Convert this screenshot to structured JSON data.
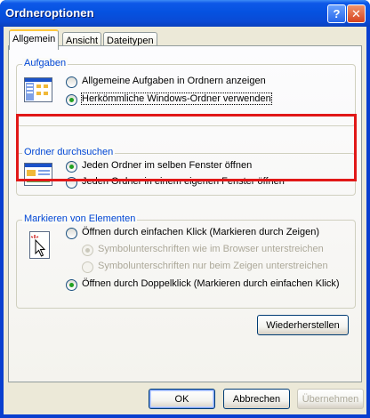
{
  "window": {
    "title": "Ordneroptionen"
  },
  "titlebar": {
    "help_glyph": "?",
    "close_glyph": "✕"
  },
  "tabs": [
    {
      "label": "Allgemein",
      "active": true
    },
    {
      "label": "Ansicht",
      "active": false
    },
    {
      "label": "Dateitypen",
      "active": false
    }
  ],
  "groups": {
    "aufgaben": {
      "legend": "Aufgaben",
      "options": [
        {
          "label": "Allgemeine Aufgaben in Ordnern anzeigen",
          "checked": false
        },
        {
          "label": "Herkömmliche Windows-Ordner verwenden",
          "checked": true
        }
      ]
    },
    "durchsuchen": {
      "legend": "Ordner durchsuchen",
      "options": [
        {
          "label": "Jeden Ordner im selben Fenster öffnen",
          "checked": true
        },
        {
          "label": "Jeden Ordner in einem eigenen Fenster öffnen",
          "checked": false
        }
      ]
    },
    "markieren": {
      "legend": "Markieren von Elementen",
      "options": [
        {
          "label": "Öffnen durch einfachen Klick (Markieren durch Zeigen)",
          "checked": false,
          "enabled": true
        },
        {
          "label": "Symbolunterschriften wie im Browser unterstreichen",
          "checked": true,
          "enabled": false
        },
        {
          "label": "Symbolunterschriften nur beim Zeigen unterstreichen",
          "checked": false,
          "enabled": false
        },
        {
          "label": "Öffnen durch Doppelklick (Markieren durch einfachen Klick)",
          "checked": true,
          "enabled": true
        }
      ]
    }
  },
  "buttons": {
    "restore": "Wiederherstellen",
    "ok": "OK",
    "cancel": "Abbrechen",
    "apply": "Übernehmen"
  },
  "colors": {
    "highlight_box": "#e11818",
    "group_legend": "#0046d5"
  }
}
